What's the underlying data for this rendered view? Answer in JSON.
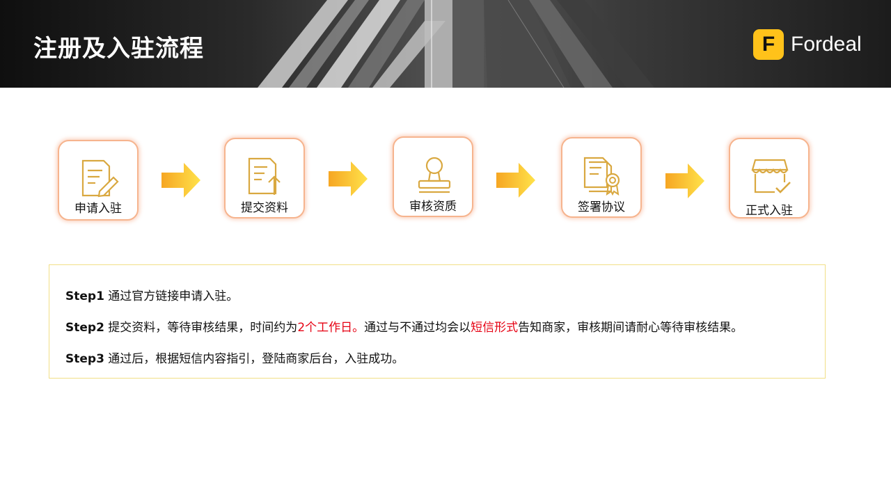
{
  "header": {
    "title": "注册及入驻流程",
    "logo": {
      "mark": "F",
      "name": "Fordeal"
    }
  },
  "colors": {
    "accent": "#ffc21a",
    "card_border": "#f6b48e",
    "icon_gold": "#d9a840",
    "highlight_red": "#e60012"
  },
  "steps": [
    {
      "label": "申请入驻",
      "icon": "document-edit-icon"
    },
    {
      "label": "提交资料",
      "icon": "document-upload-icon"
    },
    {
      "label": "审核资质",
      "icon": "stamp-icon"
    },
    {
      "label": "签署协议",
      "icon": "certificate-icon"
    },
    {
      "label": "正式入驻",
      "icon": "store-check-icon"
    }
  ],
  "details": {
    "step1": {
      "tag": "Step1",
      "text": " 通过官方链接申请入驻。"
    },
    "step2": {
      "tag": "Step2",
      "text_a": " 提交资料，等待审核结果，时间约为",
      "red_a": "2个工作日。",
      "text_b": "通过与不通过均会以",
      "red_b": "短信形式",
      "text_c": "告知商家，审核期间请耐心等待审核结果。"
    },
    "step3": {
      "tag": "Step3",
      "text": " 通过后，根据短信内容指引，登陆商家后台，入驻成功。"
    }
  }
}
